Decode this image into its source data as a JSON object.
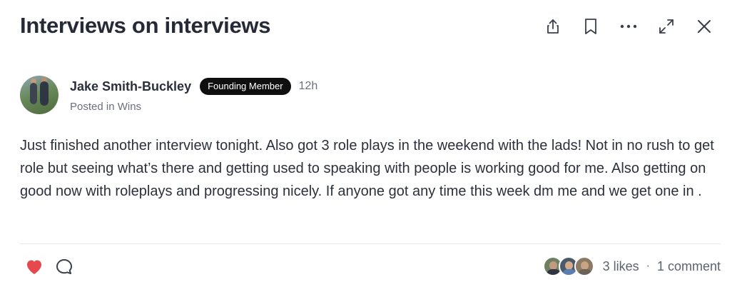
{
  "post": {
    "title": "Interviews on interviews",
    "author": {
      "name": "Jake Smith-Buckley",
      "badge": "Founding Member",
      "time": "12h",
      "posted_prefix": "Posted in ",
      "category": "Wins"
    },
    "body": "Just finished another interview tonight. Also got 3 role plays in the weekend with the lads! Not in no rush to get role but seeing what’s there and getting used to speaking with people is working good for me. Also getting on good now with roleplays and progressing nicely. If anyone got any time this week dm me and we get one in ."
  },
  "toolbar": {
    "icons": [
      "share-icon",
      "bookmark-icon",
      "more-icon",
      "expand-icon",
      "close-icon"
    ]
  },
  "footer": {
    "likes_text": "3 likes",
    "separator": "·",
    "comments_text": "1 comment"
  },
  "colors": {
    "heart": "#e5484d",
    "badge_bg": "#0f0f10",
    "title": "#252a36",
    "muted": "#6b7080"
  }
}
